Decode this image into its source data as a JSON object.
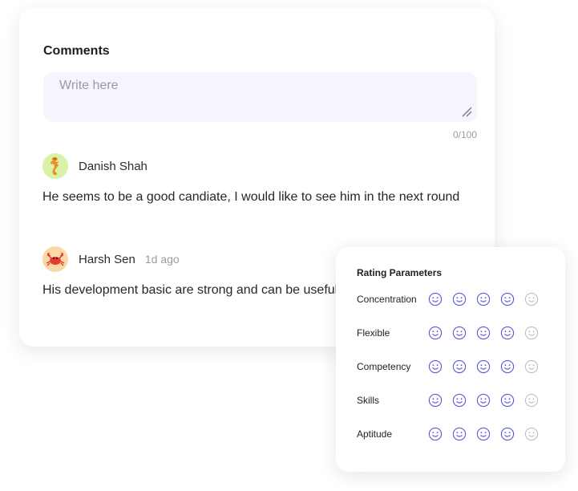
{
  "comments_panel": {
    "title": "Comments",
    "input_placeholder": "Write here",
    "input_value": "",
    "char_counter": "0/100",
    "entries": [
      {
        "author": "Danish Shah",
        "avatar_icon": "seahorse-icon",
        "time": "",
        "text": "He seems to be a good candiate, I would like to see him in the next round"
      },
      {
        "author": "Harsh Sen",
        "avatar_icon": "crab-icon",
        "time": "1d ago",
        "text": "His development basic are strong and can be useful"
      }
    ]
  },
  "rating_panel": {
    "title": "Rating Parameters",
    "scale_max": 5,
    "parameters": [
      {
        "label": "Concentration",
        "rating": 4
      },
      {
        "label": "Flexible",
        "rating": 4
      },
      {
        "label": "Competency",
        "rating": 4
      },
      {
        "label": "Skills",
        "rating": 4
      },
      {
        "label": "Aptitude",
        "rating": 4
      }
    ]
  },
  "colors": {
    "active_face": "#5a55d6",
    "inactive_face": "#bdbdc4",
    "input_background": "#f6f5fd"
  }
}
